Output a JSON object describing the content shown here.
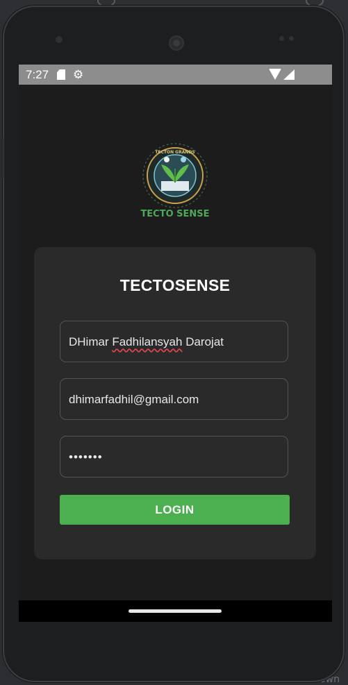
{
  "ide": {
    "bottom_label": "kdown"
  },
  "status_bar": {
    "time": "7:27",
    "sd_icon": "sd-card-icon",
    "settings_icon": "gear-icon",
    "wifi_icon": "wifi-icon",
    "signal_icon": "signal-icon"
  },
  "logo": {
    "top_text": "TECTON GRANDS",
    "ring_text": "ENVIRONMENTAL MONITORING SYSTEM",
    "wordmark": "TECTO SENSE",
    "icon": "leaf-sprout-emblem-icon"
  },
  "login": {
    "title": "TECTOSENSE",
    "name_first": "DHimar",
    "name_middle": "Fadhilansyah",
    "name_last": "Darojat",
    "email": "dhimarfadhil@gmail.com",
    "password_masked": "•••••••",
    "button_label": "LOGIN"
  },
  "colors": {
    "accent": "#4caf50",
    "card": "#2a2a2b",
    "background": "#1c1c1d",
    "status_bar": "#8d8d8d"
  }
}
